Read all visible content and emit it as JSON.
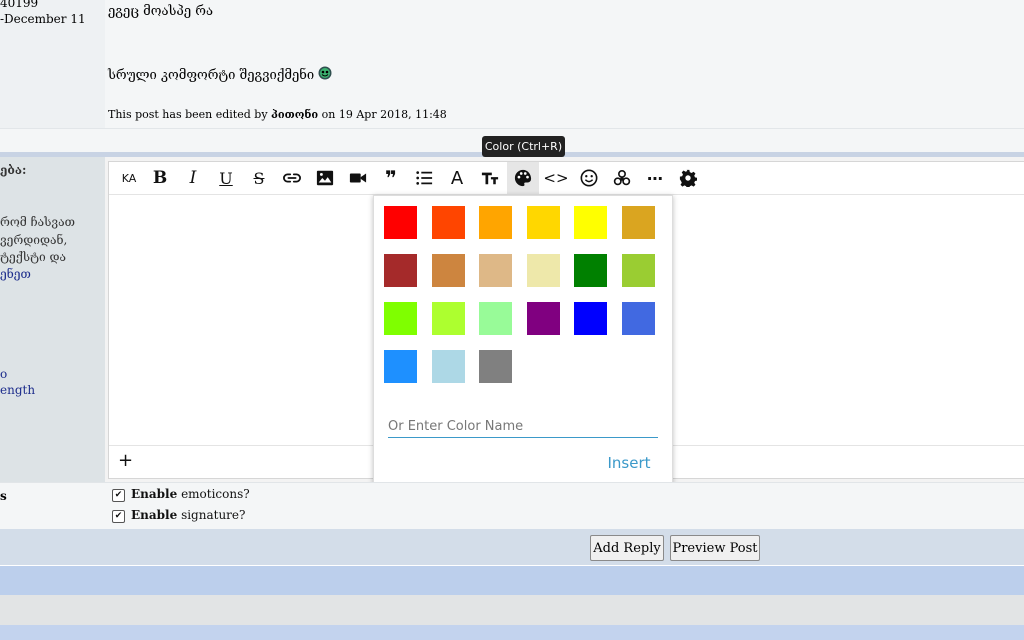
{
  "post": {
    "left_line1": "40199",
    "left_line2": "-December 11",
    "line1": "ეგეც მოასპე რა",
    "line2": "სრული კომფორტი შეგვიქმენი",
    "edited_prefix": "This post has been edited by",
    "edited_user": "პითონი",
    "edited_suffix": "on 19 Apr 2018, 11:48"
  },
  "sidebar": {
    "heading": "ება:",
    "text1": "რომ ჩასვათ",
    "text2": "ვერდიდან,",
    "text3": "ტექსტი და",
    "link1": "ენეთ",
    "link2": "o",
    "link3": "ength",
    "options_label": "s"
  },
  "toolbar": {
    "ka_label": "KA",
    "bold_label": "B",
    "italic_label": "I",
    "underline_label": "U",
    "strike_label": "S",
    "quote_label": "❞",
    "font_label": "A",
    "code_label": "<>",
    "more_label": "⋯",
    "tooltip": "Color (Ctrl+R)"
  },
  "colors": [
    "#ff0000",
    "#ff4500",
    "#ffa500",
    "#ffd700",
    "#ffff00",
    "#daa520",
    "#a52a2a",
    "#cd853f",
    "#deb887",
    "#eee8aa",
    "#008000",
    "#9acd32",
    "#7fff00",
    "#adff2f",
    "#98fb98",
    "#800080",
    "#0000ff",
    "#4169e1",
    "#1e90ff",
    "#add8e6",
    "#808080"
  ],
  "color_popup": {
    "placeholder": "Or Enter Color Name",
    "insert_label": "Insert"
  },
  "editor": {
    "add_label": "+"
  },
  "options": {
    "emoticons_bold": "Enable",
    "emoticons_rest": "emoticons?",
    "signature_bold": "Enable",
    "signature_rest": "signature?"
  },
  "buttons": {
    "add_reply": "Add Reply",
    "preview_post": "Preview Post"
  }
}
